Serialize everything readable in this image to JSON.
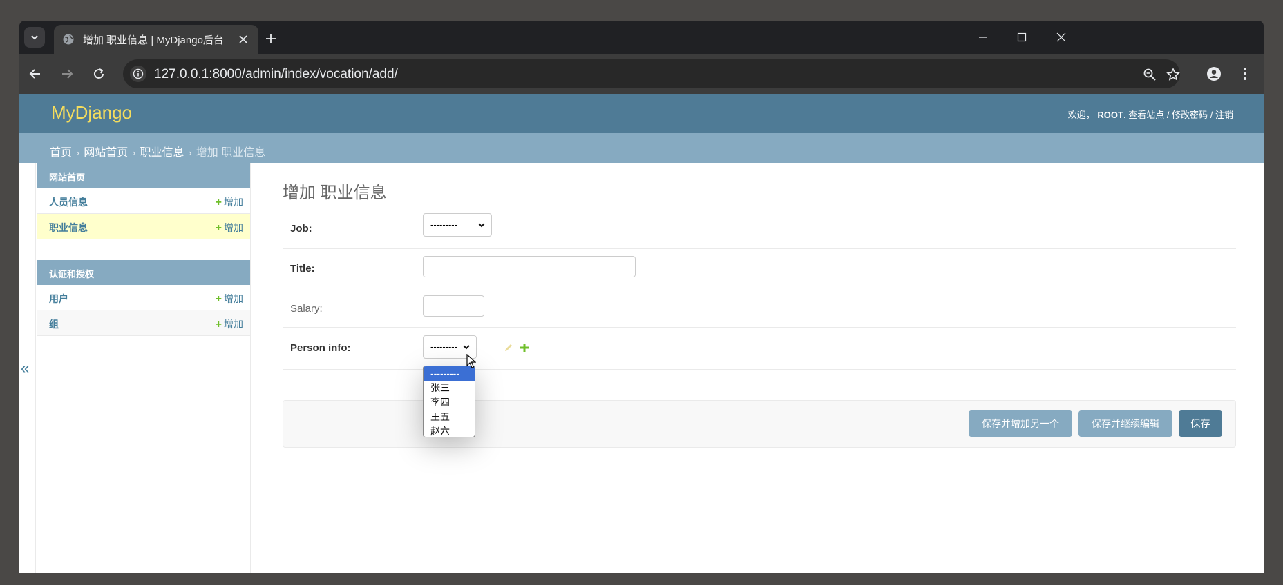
{
  "browser": {
    "tab_title": "增加 职业信息 | MyDjango后台",
    "url": "127.0.0.1:8000/admin/index/vocation/add/"
  },
  "header": {
    "brand": "MyDjango",
    "welcome": "欢迎，",
    "user": "ROOT",
    "view_site": "查看站点",
    "change_password": "修改密码",
    "logout": "注销",
    "sep": "/"
  },
  "breadcrumbs": {
    "home": "首页",
    "app": "网站首页",
    "model": "职业信息",
    "current": "增加 职业信息"
  },
  "sidebar": {
    "modules": [
      {
        "caption": "网站首页",
        "rows": [
          {
            "name": "人员信息",
            "add": "增加"
          },
          {
            "name": "职业信息",
            "add": "增加"
          }
        ]
      },
      {
        "caption": "认证和授权",
        "rows": [
          {
            "name": "用户",
            "add": "增加"
          },
          {
            "name": "组",
            "add": "增加"
          }
        ]
      }
    ],
    "collapse": "«"
  },
  "content": {
    "title": "增加 职业信息",
    "fields": {
      "job": {
        "label": "Job:",
        "value": "---------"
      },
      "title": {
        "label": "Title:",
        "value": ""
      },
      "salary": {
        "label": "Salary:",
        "value": ""
      },
      "person_info": {
        "label": "Person info:",
        "value": "---------"
      }
    },
    "buttons": {
      "save_add_another": "保存并增加另一个",
      "save_continue": "保存并继续编辑",
      "save": "保存"
    }
  },
  "dropdown": {
    "options": [
      "---------",
      "张三",
      "李四",
      "王五",
      "赵六"
    ],
    "selected_index": 0
  },
  "colors": {
    "header_bg": "#4f7b96",
    "breadcrumb_bg": "#86aac1",
    "brand": "#f5dd5d",
    "link": "#447e9b",
    "add_green": "#70bf2b"
  }
}
